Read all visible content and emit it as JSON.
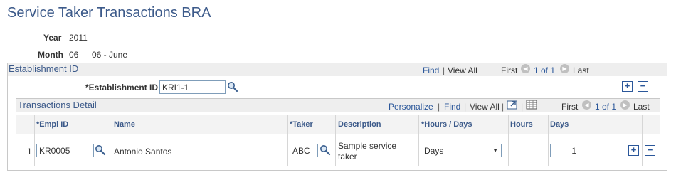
{
  "page_title": "Service Taker Transactions BRA",
  "header_fields": {
    "year_label": "Year",
    "year_value": "2011",
    "month_label": "Month",
    "month_value": "06",
    "month_desc": "06 - June"
  },
  "establishment": {
    "section_title": "Establishment ID",
    "nav": {
      "find": "Find",
      "separator": "|",
      "view_all": "View All",
      "first": "First",
      "range": "1 of 1",
      "last": "Last"
    },
    "field_label": "*Establishment ID",
    "field_value": "KRI1-1",
    "add_label": "+",
    "remove_label": "−"
  },
  "transactions": {
    "section_title": "Transactions Detail",
    "nav": {
      "personalize": "Personalize",
      "separator": "|",
      "find": "Find",
      "view_all": "View All",
      "first": "First",
      "range": "1 of 1",
      "last": "Last"
    },
    "columns": [
      "*Empl ID",
      "Name",
      "*Taker",
      "Description",
      "*Hours / Days",
      "Hours",
      "Days"
    ],
    "rows": [
      {
        "row_num": "1",
        "empl_id": "KR0005",
        "name": "Antonio Santos",
        "taker": "ABC",
        "description_line1": "Sample service",
        "description_line2": "taker",
        "hours_days": "Days",
        "hours": "",
        "days": "1",
        "add_label": "+",
        "remove_label": "−"
      }
    ]
  },
  "colors": {
    "title": "#3c5a8a",
    "link": "#2b579a",
    "header_bg": "#eeeeee",
    "border": "#c8c8c8",
    "input_border": "#7f9db9"
  },
  "icons": {
    "lookup": "magnifier-icon",
    "prev": "arrow-left-icon",
    "next": "arrow-right-icon",
    "zoom": "zoom-icon",
    "download": "grid-download-icon"
  }
}
